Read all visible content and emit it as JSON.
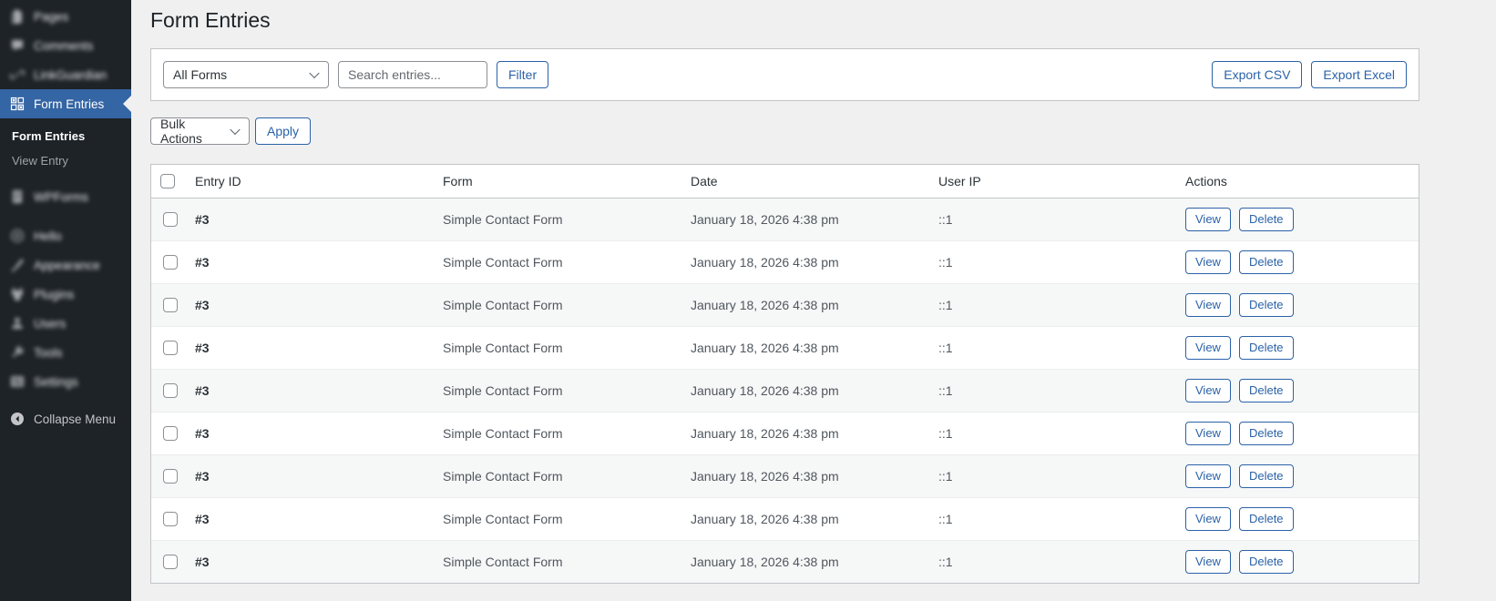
{
  "page": {
    "title": "Form Entries"
  },
  "sidebar": {
    "top_items": [
      {
        "label": "Pages",
        "icon": "pages-icon",
        "blurred": true
      },
      {
        "label": "Comments",
        "icon": "comments-icon",
        "blurred": true
      },
      {
        "label": "LinkGuardian",
        "icon": "link-icon",
        "blurred": true
      }
    ],
    "active_item": {
      "label": "Form Entries",
      "icon": "form-entries-icon"
    },
    "submenu_items": [
      {
        "label": "Form Entries",
        "current": true
      },
      {
        "label": "View Entry",
        "current": false
      }
    ],
    "bottom_items": [
      {
        "label": "WPForms",
        "icon": "wpforms-icon",
        "blurred": true,
        "group_gap": false
      },
      {
        "label": "Hello",
        "icon": "hello-icon",
        "blurred": true,
        "group_gap": true
      },
      {
        "label": "Appearance",
        "icon": "appearance-icon",
        "blurred": true,
        "group_gap": false
      },
      {
        "label": "Plugins",
        "icon": "plugins-icon",
        "blurred": true,
        "group_gap": false
      },
      {
        "label": "Users",
        "icon": "users-icon",
        "blurred": true,
        "group_gap": false
      },
      {
        "label": "Tools",
        "icon": "tools-icon",
        "blurred": true,
        "group_gap": false
      },
      {
        "label": "Settings",
        "icon": "settings-icon",
        "blurred": true,
        "group_gap": false
      }
    ],
    "collapse_item": {
      "label": "Collapse Menu",
      "icon": "collapse-icon"
    }
  },
  "filter_bar": {
    "form_select_value": "All Forms",
    "search_placeholder": "Search entries...",
    "filter_button": "Filter",
    "export_csv_button": "Export CSV",
    "export_excel_button": "Export Excel"
  },
  "bulk_bar": {
    "select_value": "Bulk Actions",
    "apply_button": "Apply"
  },
  "table": {
    "columns": [
      "Entry ID",
      "Form",
      "Date",
      "User IP",
      "Actions"
    ],
    "rows": [
      {
        "entry_id": "#3",
        "form": "Simple Contact Form",
        "date": "January 18, 2026 4:38 pm",
        "user_ip": "::1",
        "view_button": "View",
        "delete_button": "Delete"
      },
      {
        "entry_id": "#3",
        "form": "Simple Contact Form",
        "date": "January 18, 2026 4:38 pm",
        "user_ip": "::1",
        "view_button": "View",
        "delete_button": "Delete"
      },
      {
        "entry_id": "#3",
        "form": "Simple Contact Form",
        "date": "January 18, 2026 4:38 pm",
        "user_ip": "::1",
        "view_button": "View",
        "delete_button": "Delete"
      },
      {
        "entry_id": "#3",
        "form": "Simple Contact Form",
        "date": "January 18, 2026 4:38 pm",
        "user_ip": "::1",
        "view_button": "View",
        "delete_button": "Delete"
      },
      {
        "entry_id": "#3",
        "form": "Simple Contact Form",
        "date": "January 18, 2026 4:38 pm",
        "user_ip": "::1",
        "view_button": "View",
        "delete_button": "Delete"
      },
      {
        "entry_id": "#3",
        "form": "Simple Contact Form",
        "date": "January 18, 2026 4:38 pm",
        "user_ip": "::1",
        "view_button": "View",
        "delete_button": "Delete"
      },
      {
        "entry_id": "#3",
        "form": "Simple Contact Form",
        "date": "January 18, 2026 4:38 pm",
        "user_ip": "::1",
        "view_button": "View",
        "delete_button": "Delete"
      },
      {
        "entry_id": "#3",
        "form": "Simple Contact Form",
        "date": "January 18, 2026 4:38 pm",
        "user_ip": "::1",
        "view_button": "View",
        "delete_button": "Delete"
      },
      {
        "entry_id": "#3",
        "form": "Simple Contact Form",
        "date": "January 18, 2026 4:38 pm",
        "user_ip": "::1",
        "view_button": "View",
        "delete_button": "Delete"
      }
    ]
  },
  "colors": {
    "sidebar_bg": "#1d2327",
    "sidebar_active_bg": "#3465a4",
    "page_bg": "#f0f0f1",
    "card_border": "#c3c4c7",
    "row_stripe": "#f6f7f7",
    "button_accent": "#2b62a8"
  }
}
